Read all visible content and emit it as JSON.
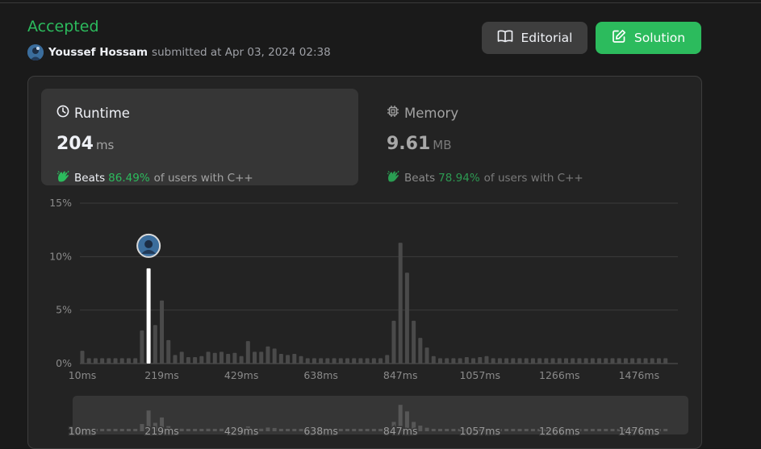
{
  "submission": {
    "status": "Accepted",
    "username": "Youssef Hossam",
    "submitted_text": "submitted at Apr 03, 2024 02:38"
  },
  "buttons": {
    "editorial": "Editorial",
    "solution": "Solution"
  },
  "colors": {
    "accent_green": "#2cbb5d",
    "bar_gray": "#4a4a4a",
    "highlight_bar": "#ffffff"
  },
  "icons": {
    "editorial": "book-icon",
    "solution": "edit-icon",
    "runtime": "clock-icon",
    "memory": "chip-icon",
    "beats": "clapping-hands-icon"
  },
  "runtime": {
    "title": "Runtime",
    "value": "204",
    "unit": "ms",
    "beats_label": "Beats",
    "beats_pct": "86.49%",
    "beats_suffix": "of users with C++"
  },
  "memory": {
    "title": "Memory",
    "value": "9.61",
    "unit": "MB",
    "beats_label": "Beats",
    "beats_pct": "78.94%",
    "beats_suffix": "of users with C++"
  },
  "chart_data": {
    "type": "bar",
    "ylabel_ticks": [
      "15%",
      "10%",
      "5%",
      "0%"
    ],
    "y_tick_values": [
      15,
      10,
      5,
      0
    ],
    "ylim": [
      0,
      15
    ],
    "grid": true,
    "xticks": [
      "10ms",
      "219ms",
      "429ms",
      "638ms",
      "847ms",
      "1057ms",
      "1266ms",
      "1476ms"
    ],
    "xlim_ms": [
      10,
      1580
    ],
    "bar_width_ms": 17.4,
    "user_runtime_ms": 204,
    "series": [
      {
        "values": [
          1.2,
          0.5,
          0.5,
          0.5,
          0.5,
          0.5,
          0.5,
          0.5,
          0.5,
          3.1,
          8.9,
          3.6,
          5.9,
          2.2,
          0.8,
          1.1,
          0.6,
          0.6,
          0.7,
          1.1,
          1,
          1.1,
          0.9,
          1,
          0.7,
          2.1,
          1.1,
          1.1,
          1.6,
          1.4,
          0.9,
          0.8,
          0.9,
          0.7,
          0.5,
          0.5,
          0.5,
          0.5,
          0.5,
          0.5,
          0.5,
          0.5,
          0.5,
          0.5,
          0.5,
          0.5,
          0.8,
          4,
          11.3,
          8.5,
          4,
          2.4,
          1.5,
          0.7,
          0.5,
          0.5,
          0.5,
          0.5,
          0.6,
          0.5,
          0.6,
          0.7,
          0.5,
          0.5,
          0.5,
          0.5,
          0.5,
          0.5,
          0.5,
          0.5,
          0.5,
          0.5,
          0.5,
          0.5,
          0.5,
          0.5,
          0.5,
          0.5,
          0.5,
          0.5,
          0.5,
          0.5,
          0.5,
          0.5,
          0.5,
          0.5,
          0.5,
          0.5,
          0.5
        ]
      }
    ],
    "highlight_index": 10,
    "navigator": {
      "xticks": [
        "10ms",
        "219ms",
        "429ms",
        "638ms",
        "847ms",
        "1057ms",
        "1266ms",
        "1476ms"
      ]
    }
  }
}
